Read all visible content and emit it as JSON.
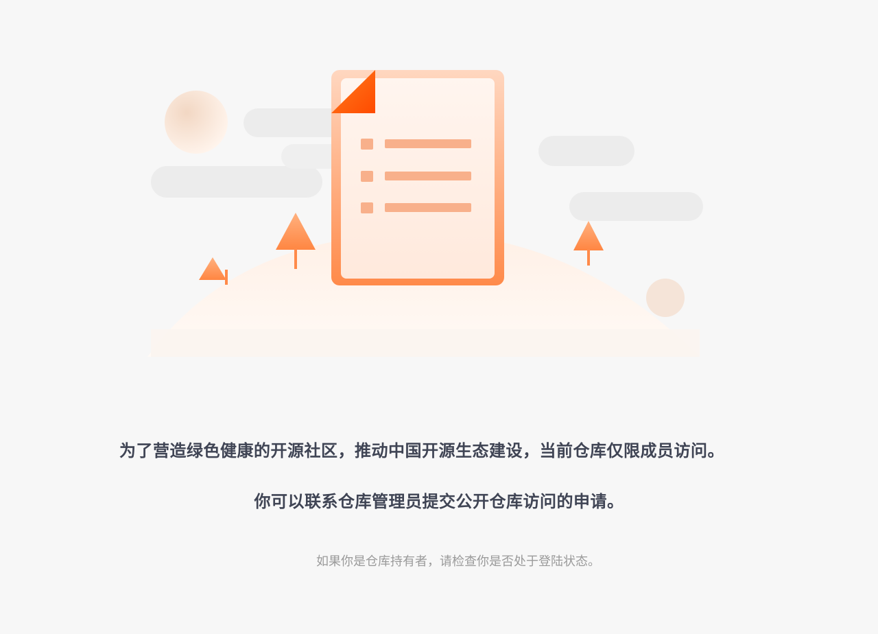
{
  "main": {
    "headline": "为了营造绿色健康的开源社区，推动中国开源生态建设，当前仓库仅限成员访问。",
    "subheadline": "你可以联系仓库管理员提交公开仓库访问的申请。",
    "hint": "如果你是仓库持有者，请检查你是否处于登陆状态。"
  },
  "illustration": {
    "icon": "document-list-icon",
    "accent_color": "#ff6a1a"
  }
}
